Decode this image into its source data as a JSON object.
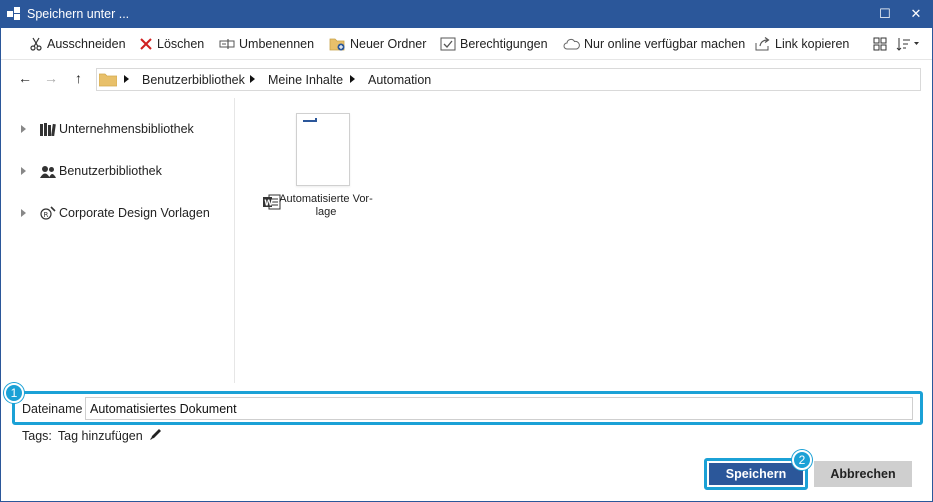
{
  "window": {
    "title": "Speichern unter ...",
    "maximize_glyph": "☐",
    "close_glyph": "✕"
  },
  "toolbar": {
    "cut": "Ausschneiden",
    "delete": "Löschen",
    "rename": "Umbenennen",
    "new_folder": "Neuer Ordner",
    "permissions": "Berechtigungen",
    "online_only": "Nur online verfügbar machen",
    "copy_link": "Link kopieren"
  },
  "nav": {
    "back": "←",
    "forward": "→",
    "up": "↑",
    "breadcrumb": [
      "Benutzerbibliothek",
      "Meine Inhalte",
      "Automation"
    ]
  },
  "sidebar": {
    "items": [
      {
        "label": "Unternehmensbibliothek",
        "icon": "books-icon"
      },
      {
        "label": "Benutzerbibliothek",
        "icon": "users-icon"
      },
      {
        "label": "Corporate Design Vorlagen",
        "icon": "corporate-design-icon"
      }
    ]
  },
  "content": {
    "files": [
      {
        "name": "Automatisierte Vor-\nlage",
        "icon": "word-icon"
      }
    ]
  },
  "footer": {
    "filename_label": "Dateiname",
    "filename_value": "Automatisiertes Dokument",
    "tags_label": "Tags:",
    "tags_action": "Tag hinzufügen",
    "save": "Speichern",
    "cancel": "Abbrechen"
  },
  "badges": {
    "filename": "1",
    "save": "2"
  },
  "colors": {
    "accent": "#2b579a",
    "highlight": "#1ba1d6"
  }
}
